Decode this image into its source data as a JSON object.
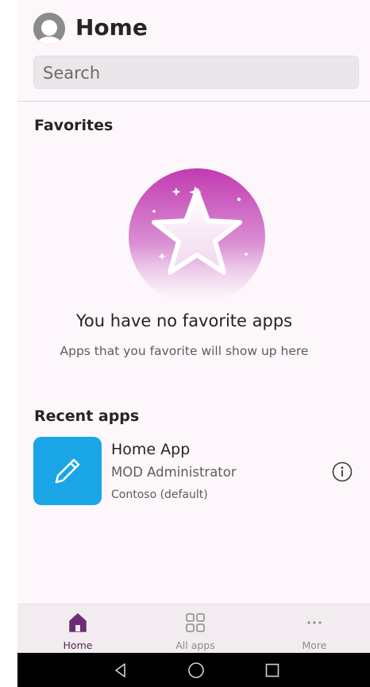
{
  "header": {
    "title": "Home",
    "search_placeholder": "Search"
  },
  "favorites": {
    "heading": "Favorites",
    "empty_title": "You have no favorite apps",
    "empty_subtitle": "Apps that you favorite will show up here"
  },
  "recent": {
    "heading": "Recent apps",
    "apps": [
      {
        "name": "Home App",
        "owner": "MOD Administrator",
        "environment": "Contoso (default)",
        "icon": "pencil-icon",
        "tile_color": "#1aa6e6"
      }
    ]
  },
  "tabbar": {
    "tabs": [
      {
        "label": "Home",
        "icon": "home-icon",
        "active": true
      },
      {
        "label": "All apps",
        "icon": "grid-icon",
        "active": false
      },
      {
        "label": "More",
        "icon": "more-icon",
        "active": false
      }
    ]
  },
  "system_nav": {
    "buttons": [
      "back-icon",
      "home-circle-icon",
      "recents-icon"
    ]
  },
  "colors": {
    "background": "#fdf7fc",
    "accent": "#6b2d73",
    "tile": "#1aa6e6",
    "star_gradient_top": "#c438b3",
    "text_secondary": "#5c5c5c"
  }
}
